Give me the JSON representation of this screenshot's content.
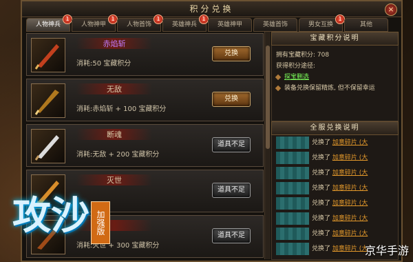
{
  "window": {
    "title": "积分兑换"
  },
  "tabs": [
    {
      "label": "人物神兵",
      "badge": "1",
      "active": true
    },
    {
      "label": "人物神甲",
      "badge": "1",
      "active": false
    },
    {
      "label": "人物首饰",
      "badge": "1",
      "active": false
    },
    {
      "label": "英雄神兵",
      "badge": "1",
      "active": false
    },
    {
      "label": "英雄神甲",
      "badge": "",
      "active": false
    },
    {
      "label": "英雄首饰",
      "badge": "",
      "active": false
    },
    {
      "label": "男女互换",
      "badge": "1",
      "active": false
    },
    {
      "label": "其他",
      "badge": "",
      "active": false
    }
  ],
  "items": [
    {
      "name": "赤焰斩",
      "name_color": "#c07cff",
      "cost": "消耗:50 宝藏积分",
      "button": "兑换",
      "enabled": true
    },
    {
      "name": "无敌",
      "name_color": "#e0d6c8",
      "cost": "消耗:赤焰斩 + 100 宝藏积分",
      "button": "兑换",
      "enabled": true
    },
    {
      "name": "断魂",
      "name_color": "#e0d6c8",
      "cost": "消耗:无敌 + 200 宝藏积分",
      "button": "道具不足",
      "enabled": false
    },
    {
      "name": "灭世",
      "name_color": "#e0d6c8",
      "cost": "",
      "button": "道具不足",
      "enabled": false
    },
    {
      "name": "",
      "name_color": "#e0d6c8",
      "cost": "消耗:灭世 + 300 宝藏积分",
      "button": "道具不足",
      "enabled": false
    }
  ],
  "info": {
    "header": "宝藏积分说明",
    "points_label": "拥有宝藏积分: 708",
    "source_label": "获得积分途径:",
    "source_link": "探宝删选",
    "note": "装备兑换保留精炼, 但不保留幸运"
  },
  "log": {
    "header": "全服兑换说明",
    "rows": [
      {
        "action": "兑换了",
        "item": "加意碎片 (大"
      },
      {
        "action": "兑换了",
        "item": "加意碎片 (大"
      },
      {
        "action": "兑换了",
        "item": "加意碎片 (大"
      },
      {
        "action": "兑换了",
        "item": "加意碎片 (大"
      },
      {
        "action": "兑换了",
        "item": "加意碎片 (大"
      },
      {
        "action": "兑换了",
        "item": "加意碎片 (大"
      },
      {
        "action": "兑换了",
        "item": "加意碎片 (大"
      },
      {
        "action": "兑换了",
        "item": "加意碎片 (大"
      }
    ]
  },
  "logo": {
    "main": "攻沙",
    "edition": "加强版"
  },
  "watermark": "京华手游",
  "colors": {
    "accent": "#c9a46a",
    "ok_button": "#a36b2e",
    "disabled_button": "#4b4b4b",
    "link": "#e79b2b",
    "source_link": "#7cff5a"
  }
}
